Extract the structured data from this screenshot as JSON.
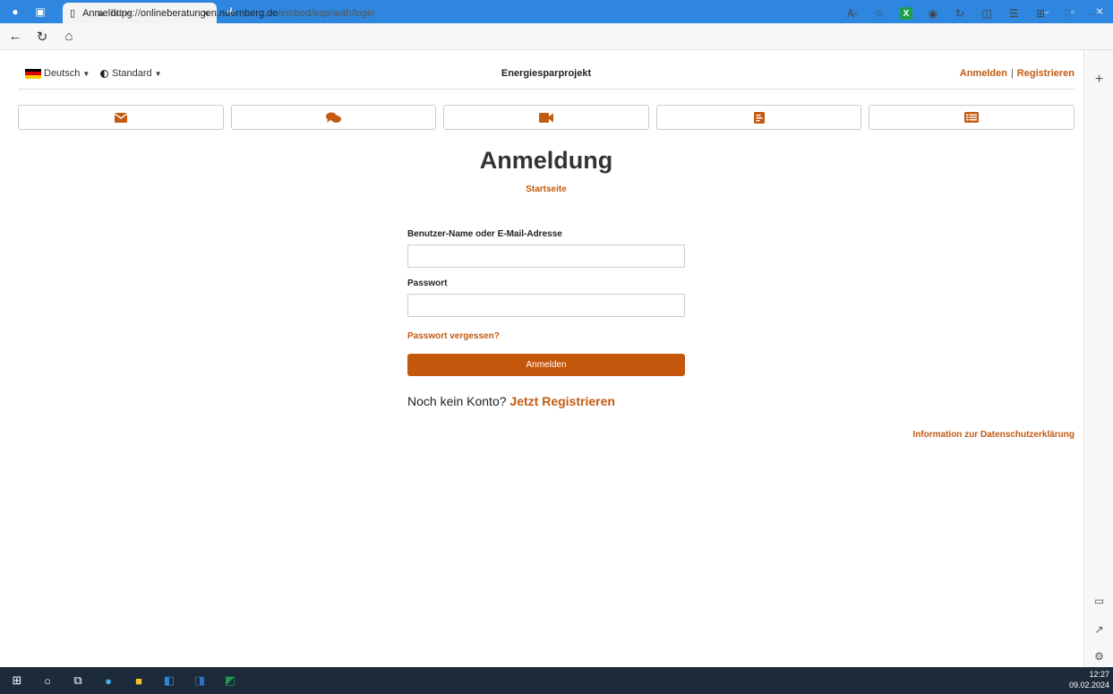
{
  "browser": {
    "tab_title": "Anmeldung",
    "tab_close": "×",
    "new_tab": "+",
    "url_prefix": "https://",
    "url_host": "onlineberatungen.nuernberg.de",
    "url_path": "/embed/esp/auth/login",
    "more": "···"
  },
  "nav": {
    "language": "Deutsch",
    "theme": "Standard",
    "site_title": "Energiesparprojekt",
    "login": "Anmelden",
    "separator": "|",
    "register": "Registrieren"
  },
  "icon_buttons": [
    "envelope-icon",
    "chat-icon",
    "video-icon",
    "document-icon",
    "list-icon"
  ],
  "main": {
    "heading": "Anmeldung",
    "home_link": "Startseite",
    "username_label": "Benutzer-Name oder E-Mail-Adresse",
    "username_value": "",
    "password_label": "Passwort",
    "password_value": "",
    "forgot_link": "Passwort vergessen?",
    "submit_label": "Anmelden",
    "no_account_text": "Noch kein Konto?",
    "register_link": "Jetzt Registrieren",
    "privacy_link": "Information zur Datenschutzerklärung"
  },
  "taskbar": {
    "time": "12:27",
    "date": "09.02.2024"
  },
  "colors": {
    "accent": "#c25a12",
    "titlebar": "#2e86de",
    "taskbar": "#1d2a3a"
  }
}
